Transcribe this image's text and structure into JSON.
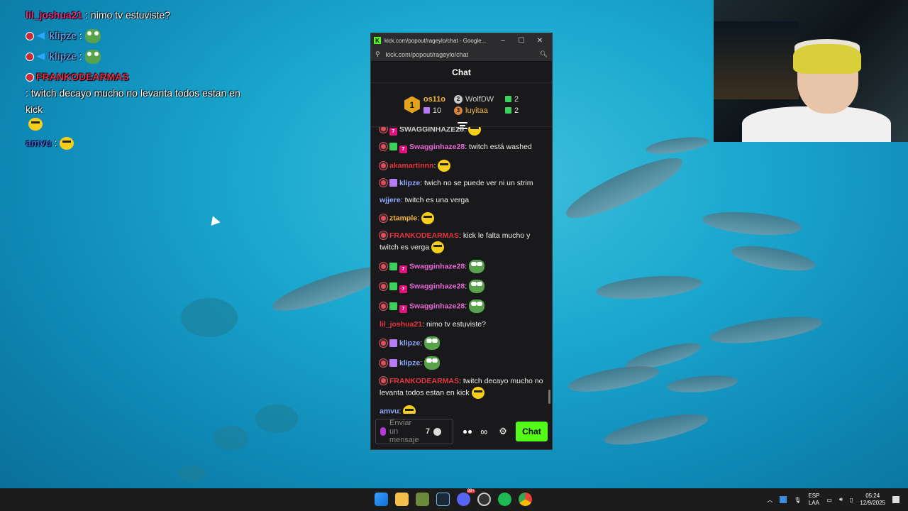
{
  "overlay_chat": [
    {
      "user": "lil_joshua21",
      "user_color": "#e52d7f",
      "text": ": nimo tv estuviste?"
    },
    {
      "user": "klipze",
      "user_color": "#5a9ce8",
      "text": ":",
      "emote": "frog"
    },
    {
      "user": "klipze",
      "user_color": "#5a9ce8",
      "text": ":",
      "emote": "frog"
    },
    {
      "user": "FRANKODEARMAS",
      "user_color": "#e52d4a",
      "text": ": twitch decayo mucho no levanta todos estan en kick",
      "emote": "yellow"
    },
    {
      "user": "amvu",
      "user_color": "#3a5fd8",
      "text": ":",
      "emote": "yellow"
    }
  ],
  "browser": {
    "title": "kick.com/popout/rageylo/chat - Google...",
    "url": "kick.com/popout/rageylo/chat",
    "minimize": "–",
    "maximize": "☐",
    "close": "✕"
  },
  "chat": {
    "header": "Chat",
    "leaderboard": {
      "first": {
        "rank": "1",
        "name": "os11o",
        "count": "10"
      },
      "second": {
        "rank": "2",
        "name": "WolfDW",
        "count": "2"
      },
      "third": {
        "rank": "3",
        "name": "luyitaa",
        "count": "2"
      }
    },
    "messages": [
      {
        "user": "SWAGGINHAZE28",
        "color": "#ccc",
        "badges": [
          "skull",
          "7"
        ],
        "text": ":",
        "emote": "yellow",
        "partial": true
      },
      {
        "user": "Swagginhaze28",
        "color": "#e966d9",
        "badges": [
          "skull",
          "gift-g",
          "7"
        ],
        "text": ": twitch está washed"
      },
      {
        "user": "akamartinnn",
        "color": "#e5363f",
        "badges": [
          "skull"
        ],
        "text": ":",
        "emote": "yellow"
      },
      {
        "user": "klipze",
        "color": "#8da8ff",
        "badges": [
          "skull",
          "gift-p"
        ],
        "text": ": twich no se puede ver ni un strim"
      },
      {
        "user": "wjjere",
        "color": "#8da8ff",
        "badges": [],
        "text": ": twitch es una verga"
      },
      {
        "user": "ztample",
        "color": "#f7b730",
        "badges": [
          "skull"
        ],
        "text": ":",
        "emote": "yellow"
      },
      {
        "user": "FRANKODEARMAS",
        "color": "#e5363f",
        "badges": [
          "skull"
        ],
        "text": ": kick le falta mucho y twitch es verga",
        "emote": "yellow"
      },
      {
        "user": "Swagginhaze28",
        "color": "#e966d9",
        "badges": [
          "skull",
          "gift-g",
          "7"
        ],
        "text": ":",
        "emote": "frog"
      },
      {
        "user": "Swagginhaze28",
        "color": "#e966d9",
        "badges": [
          "skull",
          "gift-g",
          "7"
        ],
        "text": ":",
        "emote": "frog"
      },
      {
        "user": "Swagginhaze28",
        "color": "#e966d9",
        "badges": [
          "skull",
          "gift-g",
          "7"
        ],
        "text": ":",
        "emote": "frog"
      },
      {
        "user": "lil_joshua21",
        "color": "#e5363f",
        "badges": [],
        "text": ": nimo tv estuviste?"
      },
      {
        "user": "klipze",
        "color": "#8da8ff",
        "badges": [
          "skull",
          "gift-p"
        ],
        "text": ":",
        "emote": "frog"
      },
      {
        "user": "klipze",
        "color": "#8da8ff",
        "badges": [
          "skull",
          "gift-p"
        ],
        "text": ":",
        "emote": "frog"
      },
      {
        "user": "FRANKODEARMAS",
        "color": "#e5363f",
        "badges": [
          "skull"
        ],
        "text": ": twitch decayo mucho no levanta todos estan en kick",
        "emote": "yellow"
      },
      {
        "user": "amvu",
        "color": "#8da8ff",
        "badges": [],
        "text": ":",
        "emote": "yellow"
      }
    ],
    "composer": {
      "placeholder": "Enviar un mensaje",
      "seven_tv": "7",
      "infinity": "∞",
      "gear": "⚙",
      "send_label": "Chat"
    }
  },
  "taskbar": {
    "lang_top": "ESP",
    "lang_bottom": "LAA",
    "time": "05:24",
    "date": "12/9/2025",
    "discord_badge": "99+"
  },
  "colors": {
    "kick_green": "#53fc18",
    "chat_bg": "#19191b"
  }
}
